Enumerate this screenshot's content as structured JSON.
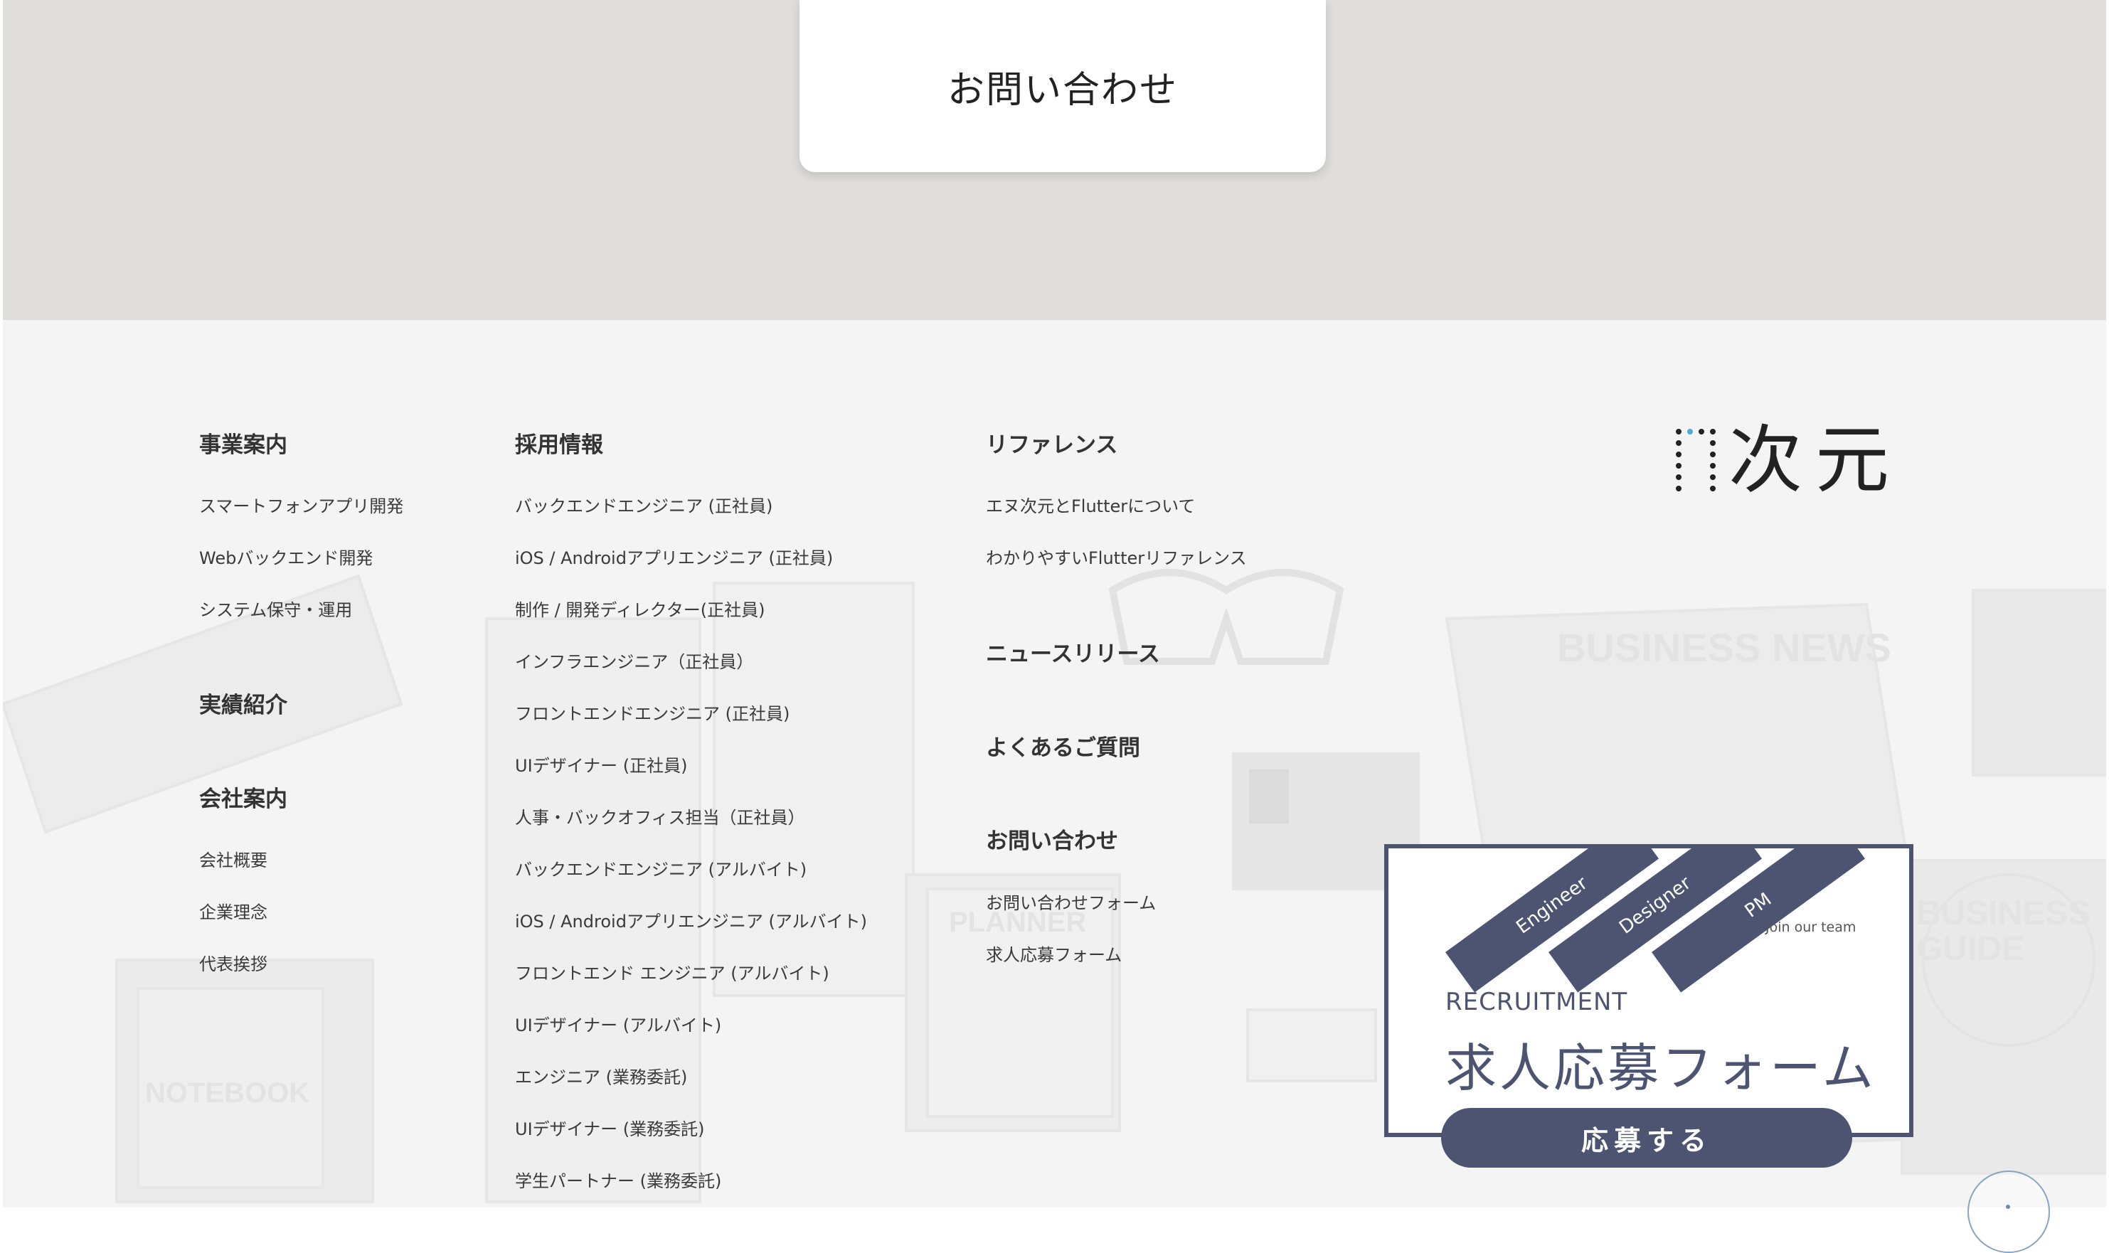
{
  "contact_cta": {
    "label": "お問い合わせ"
  },
  "footer": {
    "columns": [
      {
        "groups": [
          {
            "heading": "事業案内",
            "links": [
              "スマートフォンアプリ開発",
              "Webバックエンド開発",
              "システム保守・運用"
            ]
          },
          {
            "heading": "実績紹介",
            "links": []
          },
          {
            "heading": "会社案内",
            "links": [
              "会社概要",
              "企業理念",
              "代表挨拶"
            ]
          }
        ]
      },
      {
        "groups": [
          {
            "heading": "採用情報",
            "links": [
              "バックエンドエンジニア (正社員)",
              "iOS / Androidアプリエンジニア (正社員)",
              "制作 / 開発ディレクター(正社員)",
              "インフラエンジニア（正社員）",
              "フロントエンドエンジニア (正社員)",
              "UIデザイナー (正社員)",
              "人事・バックオフィス担当（正社員）",
              "バックエンドエンジニア (アルバイト)",
              "iOS / Androidアプリエンジニア (アルバイト)",
              "フロントエンド エンジニア (アルバイト)",
              "UIデザイナー (アルバイト)",
              "エンジニア (業務委託)",
              "UIデザイナー (業務委託)",
              "学生パートナー (業務委託)"
            ]
          }
        ]
      },
      {
        "groups": [
          {
            "heading": "リファレンス",
            "links": [
              "エヌ次元とFlutterについて",
              "わかりやすいFlutterリファレンス"
            ]
          },
          {
            "heading": "ニュースリリース",
            "links": []
          },
          {
            "heading": "よくあるご質問",
            "links": []
          },
          {
            "heading": "お問い合わせ",
            "links": [
              "お問い合わせフォーム",
              "求人応募フォーム"
            ]
          }
        ]
      }
    ],
    "logo_text": "次元",
    "bg_decor_text": {
      "business_news": "BUSINESS NEWS",
      "business_guide": [
        "BUSINESS",
        "GUIDE"
      ],
      "notebook": "NOTEBOOK",
      "planner": "PLANNER"
    }
  },
  "recruit_banner": {
    "ribbons": [
      "Engineer",
      "Designer",
      "PM"
    ],
    "join_text": "Join our team",
    "label": "RECRUITMENT",
    "title": "求人応募フォーム",
    "button_label": "応募する"
  }
}
